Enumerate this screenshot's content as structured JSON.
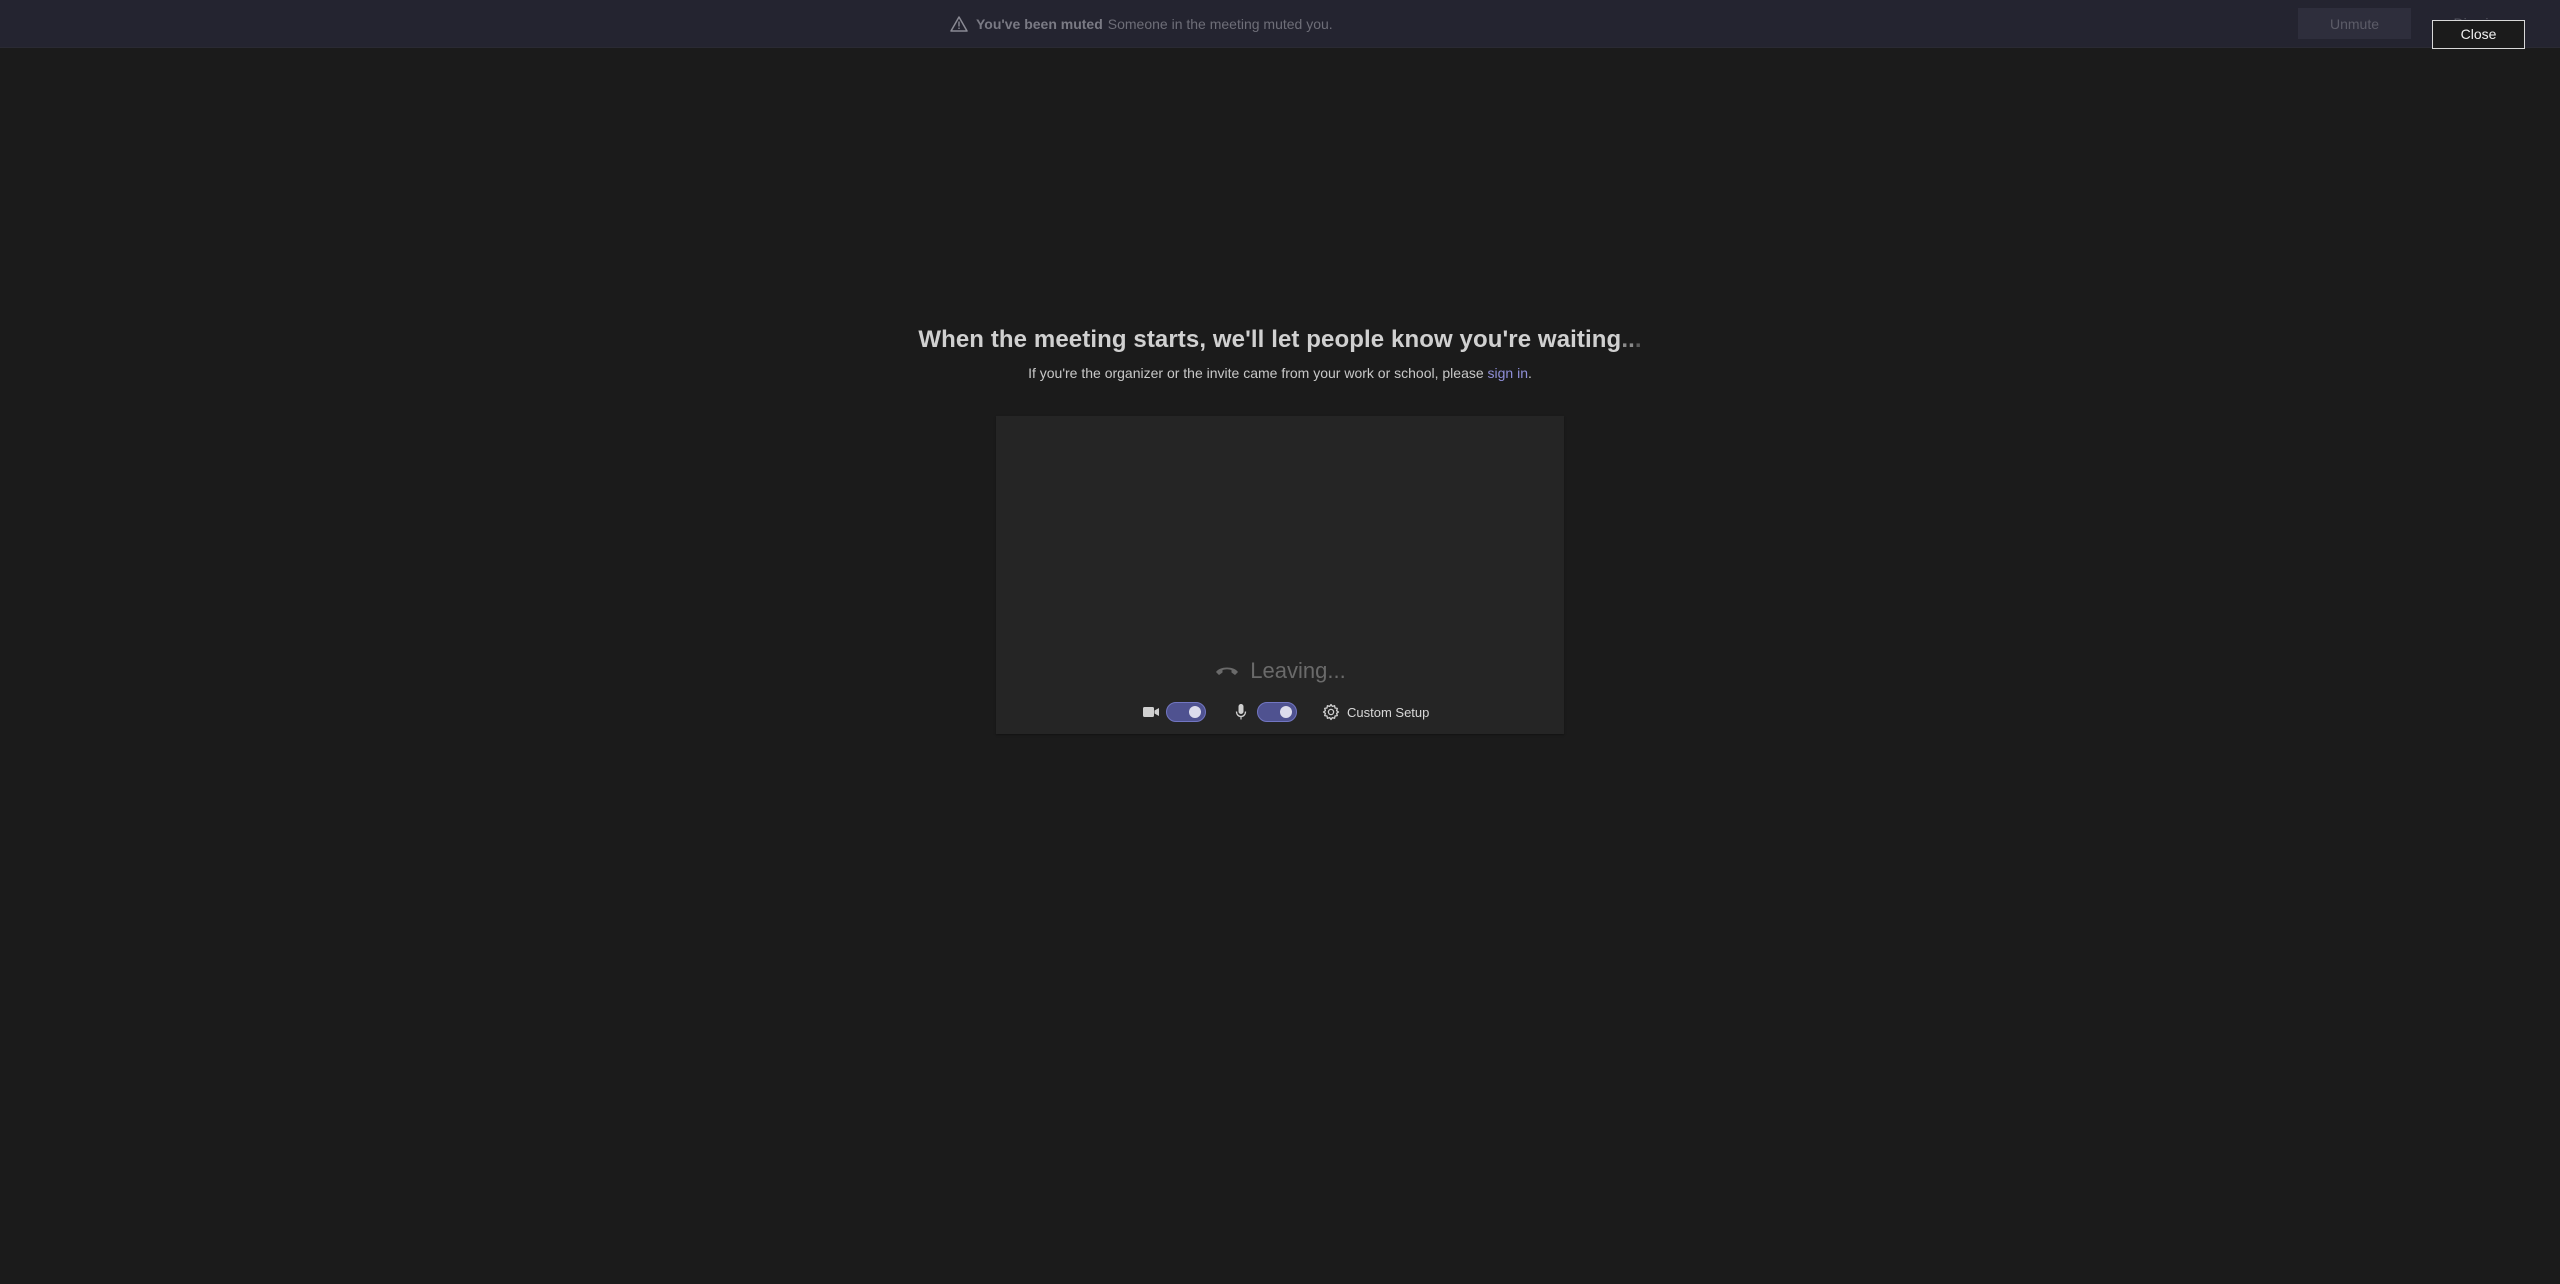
{
  "banner": {
    "title": "You've been muted",
    "message": "Someone in the meeting muted you.",
    "unmute_label": "Unmute",
    "dismiss_label": "Dismiss",
    "close_label": "Close",
    "icon": "warning-icon"
  },
  "main": {
    "heading": "When the meeting starts, we'll let people know you're waiting",
    "heading_dots": "..",
    "heading_dot_dim": ".",
    "subtext_prefix": "If you're the organizer or the invite came from your work or school, please ",
    "signin_link": "sign in",
    "subtext_suffix": "."
  },
  "preview": {
    "status": "Leaving...",
    "status_icon": "hang-up-icon",
    "camera_icon": "camera-icon",
    "camera_on": true,
    "mic_icon": "microphone-icon",
    "mic_on": true,
    "setup_icon": "gear-icon",
    "setup_label": "Custom Setup"
  },
  "colors": {
    "background": "#1b1b1b",
    "banner": "#242430",
    "panel": "#252525",
    "accent": "#4f5290",
    "link": "#8f8fd8"
  }
}
